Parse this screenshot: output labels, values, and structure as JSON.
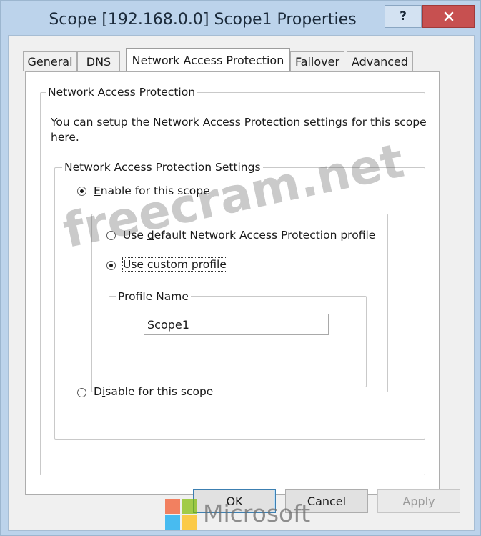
{
  "window": {
    "title": "Scope [192.168.0.0] Scope1 Properties",
    "help_label": "?"
  },
  "tabs": [
    {
      "label": "General",
      "active": false
    },
    {
      "label": "DNS",
      "active": false
    },
    {
      "label": "Network Access Protection",
      "active": true
    },
    {
      "label": "Failover",
      "active": false
    },
    {
      "label": "Advanced",
      "active": false
    }
  ],
  "nap": {
    "group_title": "Network Access Protection",
    "description_line1": "You can setup the Network Access Protection settings for this scope",
    "description_line2": "here.",
    "settings_group_title": "Network Access Protection Settings",
    "enable_option": {
      "pre": "",
      "accel": "E",
      "post": "nable for this scope",
      "selected": true
    },
    "default_profile_option": {
      "pre": "Use ",
      "accel": "d",
      "post": "efault Network Access Protection profile",
      "selected": false
    },
    "custom_profile_option": {
      "pre": "Use ",
      "accel": "c",
      "post": "ustom profile",
      "selected": true
    },
    "profile_name_group_title": "Profile Name",
    "profile_name_value": "Scope1",
    "disable_option": {
      "pre": "D",
      "accel": "i",
      "post": "sable for this scope",
      "selected": false
    }
  },
  "buttons": {
    "ok": "OK",
    "cancel": "Cancel",
    "apply": "Apply"
  },
  "watermark": {
    "site": "freecram.net",
    "brand": "Microsoft"
  },
  "colors": {
    "titlebar": "#bcd3eb",
    "close_button": "#c75050",
    "dialog_bg": "#f0f0f0",
    "ms_red": "#f25022",
    "ms_green": "#7fba00",
    "ms_blue": "#00a4ef",
    "ms_yellow": "#ffb900"
  },
  "icons": {
    "close": "close-x-icon",
    "help": "help-icon"
  }
}
